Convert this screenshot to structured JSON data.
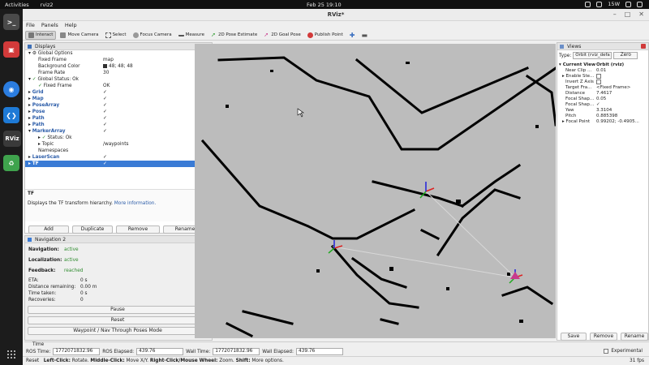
{
  "topbar": {
    "activities": "Activities",
    "app": "rviz2",
    "datetime": "Feb 25  19:10",
    "battery": "15W"
  },
  "window": {
    "title": "RViz*"
  },
  "menu": {
    "file": "File",
    "panels": "Panels",
    "help": "Help"
  },
  "toolbar": {
    "interact": "Interact",
    "move_camera": "Move Camera",
    "select": "Select",
    "focus_camera": "Focus Camera",
    "measure": "Measure",
    "pose_estimate": "2D Pose Estimate",
    "goal_pose": "2D Goal Pose",
    "publish_point": "Publish Point"
  },
  "displays": {
    "title": "Displays",
    "global_options": "Global Options",
    "fixed_frame_label": "Fixed Frame",
    "fixed_frame_value": "map",
    "bg_label": "Background Color",
    "bg_value": "48; 48; 48",
    "frame_rate_label": "Frame Rate",
    "frame_rate_value": "30",
    "global_status": "Global Status: Ok",
    "fixed_frame_status": "Fixed Frame",
    "fixed_frame_ok": "OK",
    "grid": "Grid",
    "map": "Map",
    "posearray": "PoseArray",
    "pose": "Pose",
    "path1": "Path",
    "path2": "Path",
    "markerarray": "MarkerArray",
    "status_ok": "Status: Ok",
    "topic": "Topic",
    "topic_value": "/waypoints",
    "namespaces": "Namespaces",
    "laserscan": "LaserScan",
    "tf": "TF",
    "check": "✓",
    "desc_title": "TF",
    "desc_text": "Displays the TF transform hierarchy.",
    "desc_link": "More information.",
    "add": "Add",
    "duplicate": "Duplicate",
    "remove": "Remove",
    "rename": "Rename"
  },
  "navigation": {
    "title": "Navigation 2",
    "navigation_label": "Navigation:",
    "navigation_value": "active",
    "localization_label": "Localization:",
    "localization_value": "active",
    "feedback_label": "Feedback:",
    "feedback_value": "reached",
    "eta_label": "ETA:",
    "eta_value": "0 s",
    "distance_label": "Distance remaining:",
    "distance_value": "0.00 m",
    "time_label": "Time taken:",
    "time_value": "0 s",
    "recoveries_label": "Recoveries:",
    "recoveries_value": "0",
    "pause": "Pause",
    "reset": "Reset",
    "waypoint_mode": "Waypoint / Nav Through Poses Mode"
  },
  "views": {
    "title": "Views",
    "type_label": "Type:",
    "type_value": "Orbit (rviz_defa",
    "zero": "Zero",
    "current_view": "Current View",
    "current_view_value": "Orbit (rviz)",
    "near_clip": "Near Clip ...",
    "near_clip_value": "0.01",
    "enable_stereo": "Enable Ste...",
    "invert_z": "Invert Z Axis",
    "target_frame": "Target Fra...",
    "target_frame_value": "<Fixed Frame>",
    "distance": "Distance",
    "distance_value": "7.4617",
    "focal_shape1": "Focal Shap...",
    "focal_shape1_value": "0.05",
    "focal_shape2": "Focal Shap...",
    "focal_shape2_value": "✓",
    "yaw": "Yaw",
    "yaw_value": "3.3104",
    "pitch": "Pitch",
    "pitch_value": "0.885398",
    "focal_point": "Focal Point",
    "focal_point_value": "0.99202; -0.4905...",
    "save": "Save",
    "remove": "Remove",
    "rename": "Rename"
  },
  "time": {
    "title": "Time",
    "ros_time_label": "ROS Time:",
    "ros_time": "1772071832.96",
    "ros_elapsed_label": "ROS Elapsed:",
    "ros_elapsed": "439.76",
    "wall_time_label": "Wall Time:",
    "wall_time": "1772071832.96",
    "wall_elapsed_label": "Wall Elapsed:",
    "wall_elapsed": "439.76",
    "experimental": "Experimental"
  },
  "status": {
    "reset": "Reset",
    "hint_left_click": "Left-Click:",
    "hint_left": "Rotate.",
    "hint_middle_click": "Middle-Click:",
    "hint_middle": "Move X/Y.",
    "hint_right_click": "Right-Click/Mouse Wheel:",
    "hint_right": "Zoom.",
    "hint_shift": "Shift:",
    "hint_shift_text": "More options.",
    "fps": "31 fps"
  },
  "colors": {
    "accent": "#3a7bd5",
    "active_green": "#2e8b2e",
    "map_free": "#bcbcbc",
    "map_wall": "#000000"
  }
}
